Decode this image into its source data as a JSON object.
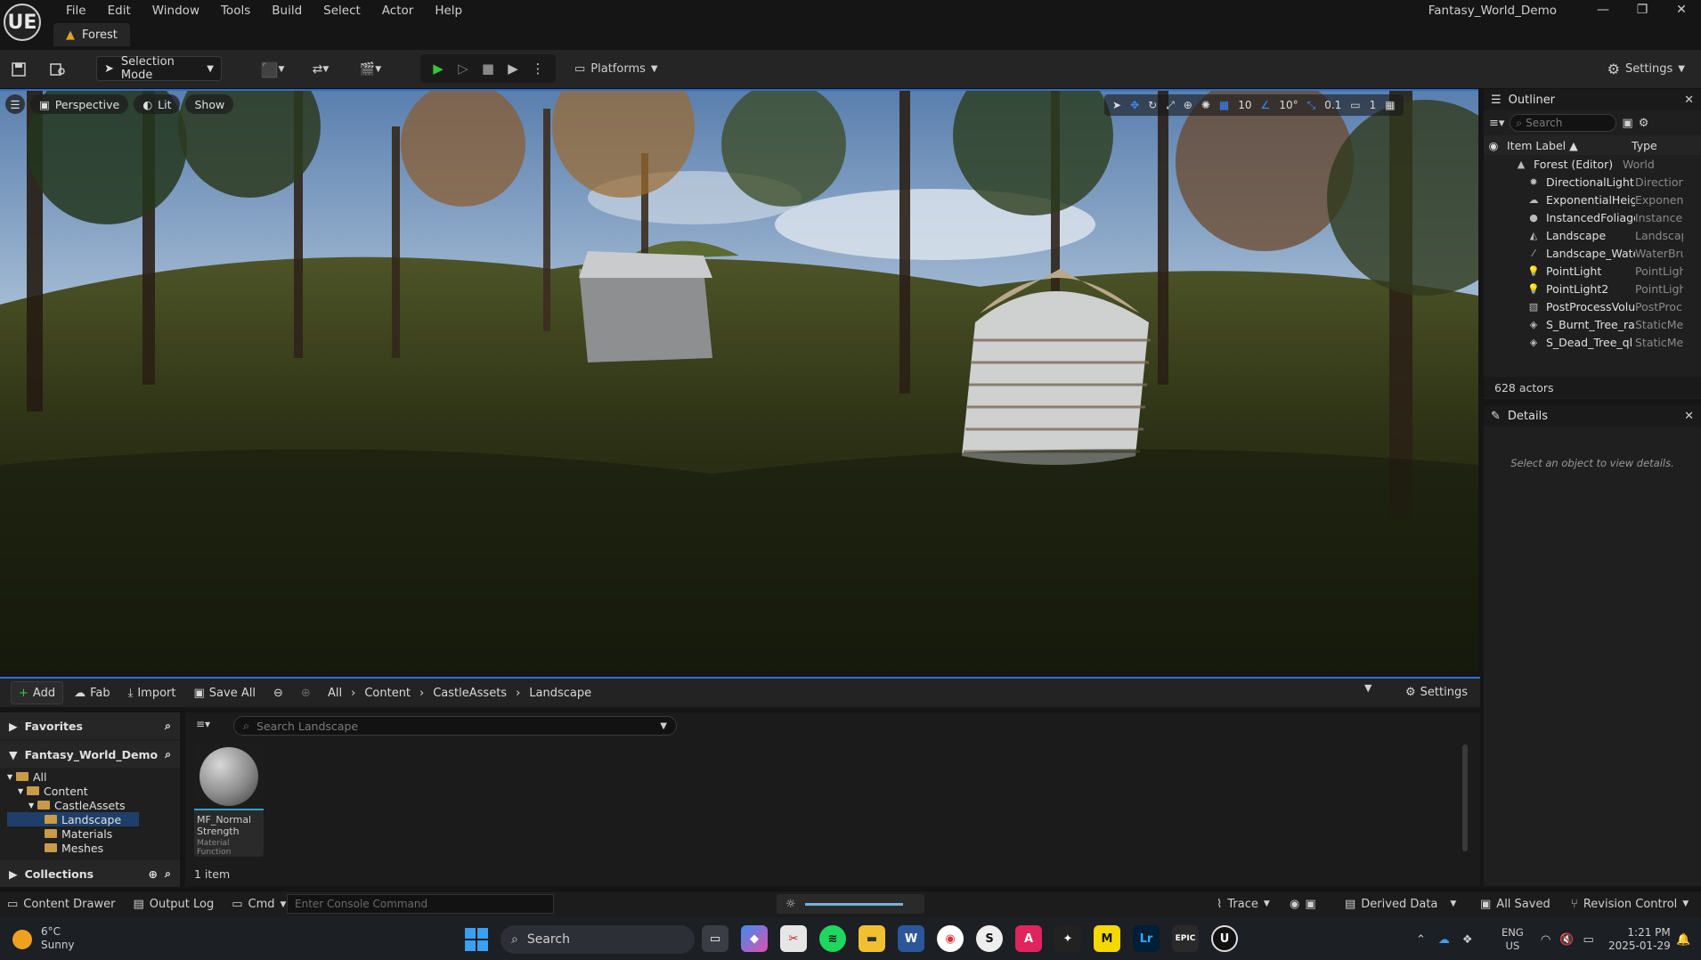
{
  "app": {
    "title": "Fantasy_World_Demo",
    "logo": "UE"
  },
  "menu": [
    "File",
    "Edit",
    "Window",
    "Tools",
    "Build",
    "Select",
    "Actor",
    "Help"
  ],
  "level_tab": "Forest",
  "toolbar": {
    "selection_mode": "Selection Mode",
    "platforms": "Platforms",
    "settings": "Settings"
  },
  "viewport": {
    "perspective": "Perspective",
    "lit": "Lit",
    "show": "Show",
    "grid_snap": "10",
    "rot_snap": "10°",
    "scale_snap": "0.1",
    "camera_speed": "1"
  },
  "outliner": {
    "title": "Outliner",
    "search_placeholder": "Search",
    "col_label": "Item Label ▲",
    "col_type": "Type",
    "rows": [
      {
        "label": "Forest (Editor)",
        "type": "World"
      },
      {
        "label": "DirectionalLight",
        "type": "Direction"
      },
      {
        "label": "ExponentialHeigh",
        "type": "Exponent"
      },
      {
        "label": "InstancedFoliage",
        "type": "Instance"
      },
      {
        "label": "Landscape",
        "type": "Landscap"
      },
      {
        "label": "Landscape_Wate",
        "type": "WaterBru"
      },
      {
        "label": "PointLight",
        "type": "PointLigh"
      },
      {
        "label": "PointLight2",
        "type": "PointLigh"
      },
      {
        "label": "PostProcessVolu",
        "type": "PostProc"
      },
      {
        "label": "S_Burnt_Tree_ra",
        "type": "StaticMe"
      },
      {
        "label": "S_Dead_Tree_ql",
        "type": "StaticMe"
      }
    ],
    "count": "628 actors"
  },
  "details": {
    "title": "Details",
    "empty": "Select an object to view details."
  },
  "content_browser": {
    "add": "Add",
    "fab": "Fab",
    "import": "Import",
    "save_all": "Save All",
    "breadcrumb": [
      "All",
      "Content",
      "CastleAssets",
      "Landscape"
    ],
    "settings": "Settings",
    "favorites": "Favorites",
    "project": "Fantasy_World_Demo",
    "collections": "Collections",
    "tree": [
      {
        "label": "All",
        "depth": 0
      },
      {
        "label": "Content",
        "depth": 1
      },
      {
        "label": "CastleAssets",
        "depth": 2
      },
      {
        "label": "Landscape",
        "depth": 3,
        "selected": true
      },
      {
        "label": "Materials",
        "depth": 3
      },
      {
        "label": "Meshes",
        "depth": 3
      }
    ],
    "search_placeholder": "Search Landscape",
    "asset": {
      "name": "MF_Normal Strength",
      "type": "Material Function"
    },
    "item_count": "1 item"
  },
  "status": {
    "content_drawer": "Content Drawer",
    "output_log": "Output Log",
    "cmd": "Cmd",
    "console_placeholder": "Enter Console Command",
    "trace": "Trace",
    "derived_data": "Derived Data",
    "all_saved": "All Saved",
    "revision_control": "Revision Control"
  },
  "taskbar": {
    "weather_temp": "6°C",
    "weather_desc": "Sunny",
    "search": "Search",
    "lang": "ENG",
    "region": "US",
    "time": "1:21 PM",
    "date": "2025-01-29"
  }
}
